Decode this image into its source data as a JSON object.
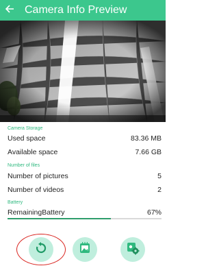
{
  "header": {
    "title": "Camera Info Preview",
    "background": "#3cc78d",
    "back_icon": "arrow-left-icon"
  },
  "preview": {
    "description_icon": "camera-preview-image"
  },
  "storage": {
    "section_label": "Camera Storage",
    "used_label": "Used space",
    "used_value": "83.36 MB",
    "available_label": "Available space",
    "available_value": "7.66 GB"
  },
  "files": {
    "section_label": "Number of files",
    "pictures_label": "Number of pictures",
    "pictures_value": "5",
    "videos_label": "Number of videos",
    "videos_value": "2"
  },
  "battery": {
    "section_label": "Battery",
    "label": "RemainingBattery",
    "value": "67%",
    "level": 0.67
  },
  "actions": {
    "refresh_icon": "refresh-icon",
    "gallery_icon": "gallery-icon",
    "settings_icon": "camera-settings-icon"
  },
  "colors": {
    "accent": "#3cc78d",
    "section_label": "#2fb97f",
    "highlight": "#d9231e"
  }
}
